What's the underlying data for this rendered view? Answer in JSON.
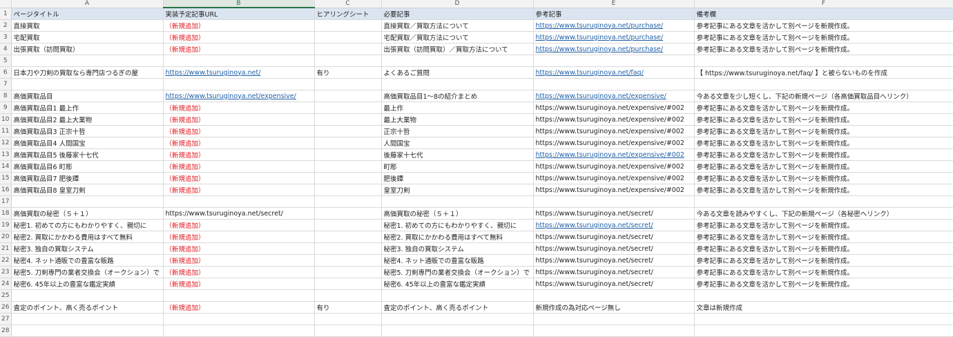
{
  "columns": [
    "A",
    "B",
    "C",
    "D",
    "E",
    "F"
  ],
  "rows": [
    {
      "n": "1",
      "hdr": true,
      "cells": [
        {
          "t": "ページタイトル"
        },
        {
          "t": "実装予定記事URL"
        },
        {
          "t": "ヒアリングシート"
        },
        {
          "t": "必要記事"
        },
        {
          "t": "参考記事"
        },
        {
          "t": "備考欄"
        }
      ]
    },
    {
      "n": "2",
      "cells": [
        {
          "t": "直接買取"
        },
        {
          "t": "（新規追加）",
          "s": "red"
        },
        {
          "t": ""
        },
        {
          "t": "直接買取／買取方法について"
        },
        {
          "t": "https://www.tsuruginoya.net/purchase/",
          "s": "link"
        },
        {
          "t": "参考記事にある文章を活かして別ページを新規作成。"
        }
      ]
    },
    {
      "n": "3",
      "cells": [
        {
          "t": "宅配買取"
        },
        {
          "t": "（新規追加）",
          "s": "red"
        },
        {
          "t": ""
        },
        {
          "t": "宅配買取／買取方法について"
        },
        {
          "t": "https://www.tsuruginoya.net/purchase/",
          "s": "link"
        },
        {
          "t": "参考記事にある文章を活かして別ページを新規作成。"
        }
      ]
    },
    {
      "n": "4",
      "cells": [
        {
          "t": "出張買取（訪問買取）"
        },
        {
          "t": "（新規追加）",
          "s": "red"
        },
        {
          "t": ""
        },
        {
          "t": "出張買取（訪問買取）／買取方法について"
        },
        {
          "t": "https://www.tsuruginoya.net/purchase/",
          "s": "link"
        },
        {
          "t": "参考記事にある文章を活かして別ページを新規作成。"
        }
      ]
    },
    {
      "n": "5",
      "cells": [
        {
          "t": ""
        },
        {
          "t": ""
        },
        {
          "t": ""
        },
        {
          "t": ""
        },
        {
          "t": ""
        },
        {
          "t": ""
        }
      ]
    },
    {
      "n": "6",
      "cells": [
        {
          "t": "日本刀や刀剣の買取なら専門店つるぎの屋"
        },
        {
          "t": "https://www.tsuruginoya.net/",
          "s": "link"
        },
        {
          "t": "有り"
        },
        {
          "t": "よくあるご質問"
        },
        {
          "t": "https://www.tsuruginoya.net/faq/",
          "s": "link"
        },
        {
          "t": "【 https://www.tsuruginoya.net/faq/ 】と被らないものを作成"
        }
      ]
    },
    {
      "n": "7",
      "cells": [
        {
          "t": ""
        },
        {
          "t": ""
        },
        {
          "t": ""
        },
        {
          "t": ""
        },
        {
          "t": ""
        },
        {
          "t": ""
        }
      ]
    },
    {
      "n": "8",
      "cells": [
        {
          "t": "高価買取品目"
        },
        {
          "t": "https://www.tsuruginoya.net/expensive/",
          "s": "link"
        },
        {
          "t": ""
        },
        {
          "t": "高価買取品目1〜8の紹介まとめ"
        },
        {
          "t": "https://www.tsuruginoya.net/expensive/",
          "s": "link"
        },
        {
          "t": "今ある文章を少し短くし、下記の新規ページ（各高価買取品目へリンク）"
        }
      ]
    },
    {
      "n": "9",
      "cells": [
        {
          "t": "高価買取品目1 最上作"
        },
        {
          "t": "（新規追加）",
          "s": "red"
        },
        {
          "t": ""
        },
        {
          "t": "最上作"
        },
        {
          "t": "https://www.tsuruginoya.net/expensive/#002"
        },
        {
          "t": "参考記事にある文章を活かして別ページを新規作成。"
        }
      ]
    },
    {
      "n": "10",
      "cells": [
        {
          "t": "高価買取品目2 最上大業物"
        },
        {
          "t": "（新規追加）",
          "s": "red"
        },
        {
          "t": ""
        },
        {
          "t": "最上大業物"
        },
        {
          "t": "https://www.tsuruginoya.net/expensive/#002"
        },
        {
          "t": "参考記事にある文章を活かして別ページを新規作成。"
        }
      ]
    },
    {
      "n": "11",
      "cells": [
        {
          "t": "高価買取品目3 正宗十哲"
        },
        {
          "t": "（新規追加）",
          "s": "red"
        },
        {
          "t": ""
        },
        {
          "t": "正宗十哲"
        },
        {
          "t": "https://www.tsuruginoya.net/expensive/#002"
        },
        {
          "t": "参考記事にある文章を活かして別ページを新規作成。"
        }
      ]
    },
    {
      "n": "12",
      "cells": [
        {
          "t": "高価買取品目4 人間国宝"
        },
        {
          "t": "（新規追加）",
          "s": "red"
        },
        {
          "t": ""
        },
        {
          "t": "人間国宝"
        },
        {
          "t": "https://www.tsuruginoya.net/expensive/#002"
        },
        {
          "t": "参考記事にある文章を活かして別ページを新規作成。"
        }
      ]
    },
    {
      "n": "13",
      "cells": [
        {
          "t": "高価買取品目5 後藤家十七代"
        },
        {
          "t": "（新規追加）",
          "s": "red"
        },
        {
          "t": ""
        },
        {
          "t": "後藤家十七代"
        },
        {
          "t": "https://www.tsuruginoya.net/expensive/#002",
          "s": "link"
        },
        {
          "t": "参考記事にある文章を活かして別ページを新規作成。"
        }
      ]
    },
    {
      "n": "14",
      "cells": [
        {
          "t": "高価買取品目6 町彫"
        },
        {
          "t": "（新規追加）",
          "s": "red"
        },
        {
          "t": ""
        },
        {
          "t": "町彫"
        },
        {
          "t": "https://www.tsuruginoya.net/expensive/#002"
        },
        {
          "t": "参考記事にある文章を活かして別ページを新規作成。"
        }
      ]
    },
    {
      "n": "15",
      "cells": [
        {
          "t": "高価買取品目7 肥後鐔"
        },
        {
          "t": "（新規追加）",
          "s": "red"
        },
        {
          "t": ""
        },
        {
          "t": "肥後鐔"
        },
        {
          "t": "https://www.tsuruginoya.net/expensive/#002"
        },
        {
          "t": "参考記事にある文章を活かして別ページを新規作成。"
        }
      ]
    },
    {
      "n": "16",
      "cells": [
        {
          "t": "高価買取品目8 皇室刀剣"
        },
        {
          "t": "（新規追加）",
          "s": "red"
        },
        {
          "t": ""
        },
        {
          "t": "皇室刀剣"
        },
        {
          "t": "https://www.tsuruginoya.net/expensive/#002"
        },
        {
          "t": "参考記事にある文章を活かして別ページを新規作成。"
        }
      ]
    },
    {
      "n": "17",
      "cells": [
        {
          "t": ""
        },
        {
          "t": ""
        },
        {
          "t": ""
        },
        {
          "t": ""
        },
        {
          "t": ""
        },
        {
          "t": ""
        }
      ]
    },
    {
      "n": "18",
      "cells": [
        {
          "t": "高価買取の秘密（５＋１）"
        },
        {
          "t": "https://www.tsuruginoya.net/secret/"
        },
        {
          "t": ""
        },
        {
          "t": "高価買取の秘密（５＋１）"
        },
        {
          "t": "https://www.tsuruginoya.net/secret/"
        },
        {
          "t": "今ある文章を読みやすくし、下記の新規ページ（各秘密へリンク）"
        }
      ]
    },
    {
      "n": "19",
      "cells": [
        {
          "t": "秘密1. 初めての方にもわかりやすく、親切に"
        },
        {
          "t": "（新規追加）",
          "s": "red"
        },
        {
          "t": ""
        },
        {
          "t": "秘密1. 初めての方にもわかりやすく、親切に"
        },
        {
          "t": "https://www.tsuruginoya.net/secret/",
          "s": "link"
        },
        {
          "t": "参考記事にある文章を活かして別ページを新規作成。"
        }
      ]
    },
    {
      "n": "20",
      "cells": [
        {
          "t": "秘密2. 買取にかかわる費用はすべて無料"
        },
        {
          "t": "（新規追加）",
          "s": "red"
        },
        {
          "t": ""
        },
        {
          "t": "秘密2. 買取にかかわる費用はすべて無料"
        },
        {
          "t": "https://www.tsuruginoya.net/secret/"
        },
        {
          "t": "参考記事にある文章を活かして別ページを新規作成。"
        }
      ]
    },
    {
      "n": "21",
      "cells": [
        {
          "t": "秘密3. 独自の買取システム"
        },
        {
          "t": "（新規追加）",
          "s": "red"
        },
        {
          "t": ""
        },
        {
          "t": "秘密3. 独自の買取システム"
        },
        {
          "t": "https://www.tsuruginoya.net/secret/"
        },
        {
          "t": "参考記事にある文章を活かして別ページを新規作成。"
        }
      ]
    },
    {
      "n": "22",
      "cells": [
        {
          "t": "秘密4. ネット通販での豊富な販路"
        },
        {
          "t": "（新規追加）",
          "s": "red"
        },
        {
          "t": ""
        },
        {
          "t": "秘密4. ネット通販での豊富な販路"
        },
        {
          "t": "https://www.tsuruginoya.net/secret/"
        },
        {
          "t": "参考記事にある文章を活かして別ページを新規作成。"
        }
      ]
    },
    {
      "n": "23",
      "cells": [
        {
          "t": "秘密5. 刀剣専門の業者交換会（オークション）で"
        },
        {
          "t": "（新規追加）",
          "s": "red"
        },
        {
          "t": ""
        },
        {
          "t": "秘密5. 刀剣専門の業者交換会（オークション）で"
        },
        {
          "t": "https://www.tsuruginoya.net/secret/"
        },
        {
          "t": "参考記事にある文章を活かして別ページを新規作成。"
        }
      ]
    },
    {
      "n": "24",
      "cells": [
        {
          "t": "秘密6. 45年以上の豊富な鑑定実績"
        },
        {
          "t": "（新規追加）",
          "s": "red"
        },
        {
          "t": ""
        },
        {
          "t": "秘密6. 45年以上の豊富な鑑定実績"
        },
        {
          "t": "https://www.tsuruginoya.net/secret/"
        },
        {
          "t": "参考記事にある文章を活かして別ページを新規作成。"
        }
      ]
    },
    {
      "n": "25",
      "cells": [
        {
          "t": ""
        },
        {
          "t": ""
        },
        {
          "t": ""
        },
        {
          "t": ""
        },
        {
          "t": ""
        },
        {
          "t": ""
        }
      ]
    },
    {
      "n": "26",
      "cells": [
        {
          "t": "査定のポイント、高く売るポイント"
        },
        {
          "t": "（新規追加）",
          "s": "red"
        },
        {
          "t": "有り"
        },
        {
          "t": "査定のポイント、高く売るポイント"
        },
        {
          "t": "新規作成の為対応ページ無し"
        },
        {
          "t": "文章は新規作成"
        }
      ]
    },
    {
      "n": "27",
      "cells": [
        {
          "t": ""
        },
        {
          "t": ""
        },
        {
          "t": ""
        },
        {
          "t": ""
        },
        {
          "t": ""
        },
        {
          "t": ""
        }
      ]
    },
    {
      "n": "28",
      "cells": [
        {
          "t": ""
        },
        {
          "t": ""
        },
        {
          "t": ""
        },
        {
          "t": ""
        },
        {
          "t": ""
        },
        {
          "t": ""
        }
      ]
    }
  ]
}
